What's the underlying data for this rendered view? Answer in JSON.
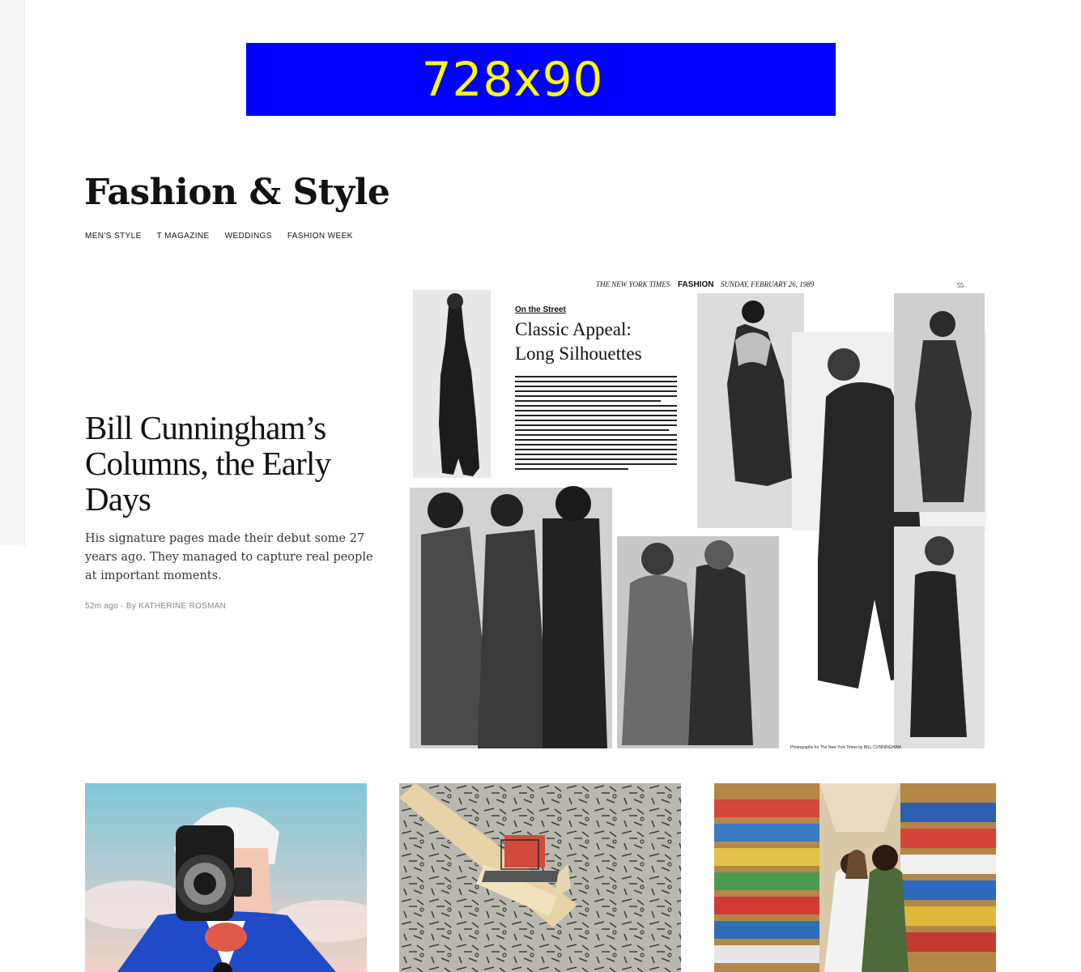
{
  "ad": {
    "label": "728x90"
  },
  "section": {
    "title": "Fashion & Style"
  },
  "subnav": [
    {
      "label": "MEN'S STYLE"
    },
    {
      "label": "T MAGAZINE"
    },
    {
      "label": "WEDDINGS"
    },
    {
      "label": "FASHION WEEK"
    }
  ],
  "lead": {
    "headline": "Bill Cunningham’s Columns, the Early Days",
    "summary": "His signature pages made their debut some 27 years ago. They managed to capture real people at important moments.",
    "time": "52m ago",
    "by": "By",
    "author": "KATHERINE ROSMAN",
    "clipping": {
      "masthead": "THE NEW YORK TIMES",
      "section": "FASHION",
      "date": "SUNDAY, FEBRUARY 26, 1989",
      "page": "55",
      "kicker": "On the Street",
      "headline_line1": "Classic Appeal:",
      "headline_line2": "Long Silhouettes",
      "credit": "Photographs for The New York Times by BILL CUNNINGHAM"
    }
  },
  "colors": {
    "ad_background": "#0000ff",
    "ad_text": "#ffff00"
  }
}
